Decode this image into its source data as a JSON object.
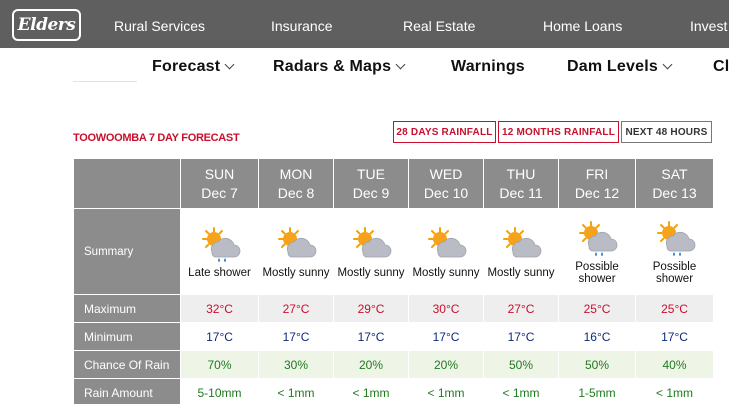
{
  "topnav": {
    "logo": "Elders",
    "items": [
      "Rural Services",
      "Insurance",
      "Real Estate",
      "Home Loans",
      "Invest"
    ]
  },
  "subnav": {
    "items": [
      "Forecast",
      "Radars & Maps",
      "Warnings",
      "Dam Levels",
      "Cl"
    ]
  },
  "page": {
    "title": "TOOWOOMBA 7 DAY FORECAST",
    "buttons": [
      "28 DAYS RAINFALL",
      "12 MONTHS RAINFALL",
      "NEXT 48 HOURS"
    ]
  },
  "forecast": {
    "row_labels": {
      "summary": "Summary",
      "maximum": "Maximum",
      "minimum": "Minimum",
      "chance": "Chance Of Rain",
      "amount": "Rain Amount"
    },
    "days": [
      {
        "day": "SUN",
        "date": "Dec 7",
        "icon": "cloud-sun-rain-icon",
        "summary": "Late shower",
        "max": "32°C",
        "min": "17°C",
        "chance": "70%",
        "amount": "5-10mm"
      },
      {
        "day": "MON",
        "date": "Dec 8",
        "icon": "partly-sunny-icon",
        "summary": "Mostly sunny",
        "max": "27°C",
        "min": "17°C",
        "chance": "30%",
        "amount": "< 1mm"
      },
      {
        "day": "TUE",
        "date": "Dec 9",
        "icon": "partly-sunny-icon",
        "summary": "Mostly sunny",
        "max": "29°C",
        "min": "17°C",
        "chance": "20%",
        "amount": "< 1mm"
      },
      {
        "day": "WED",
        "date": "Dec 10",
        "icon": "partly-sunny-icon",
        "summary": "Mostly sunny",
        "max": "30°C",
        "min": "17°C",
        "chance": "20%",
        "amount": "< 1mm"
      },
      {
        "day": "THU",
        "date": "Dec 11",
        "icon": "partly-sunny-icon",
        "summary": "Mostly sunny",
        "max": "27°C",
        "min": "17°C",
        "chance": "50%",
        "amount": "< 1mm"
      },
      {
        "day": "FRI",
        "date": "Dec 12",
        "icon": "cloud-sun-rain-icon",
        "summary": "Possible shower",
        "max": "25°C",
        "min": "16°C",
        "chance": "50%",
        "amount": "1-5mm"
      },
      {
        "day": "SAT",
        "date": "Dec 13",
        "icon": "cloud-sun-rain-icon",
        "summary": "Possible shower",
        "max": "25°C",
        "min": "17°C",
        "chance": "40%",
        "amount": "< 1mm"
      }
    ]
  },
  "colors": {
    "topbar": "#5f5f5f",
    "accent_red": "#c8102e",
    "header_grey": "#8c8c8c",
    "min_blue": "#0d2a7a",
    "rain_green": "#1f7a1f"
  }
}
